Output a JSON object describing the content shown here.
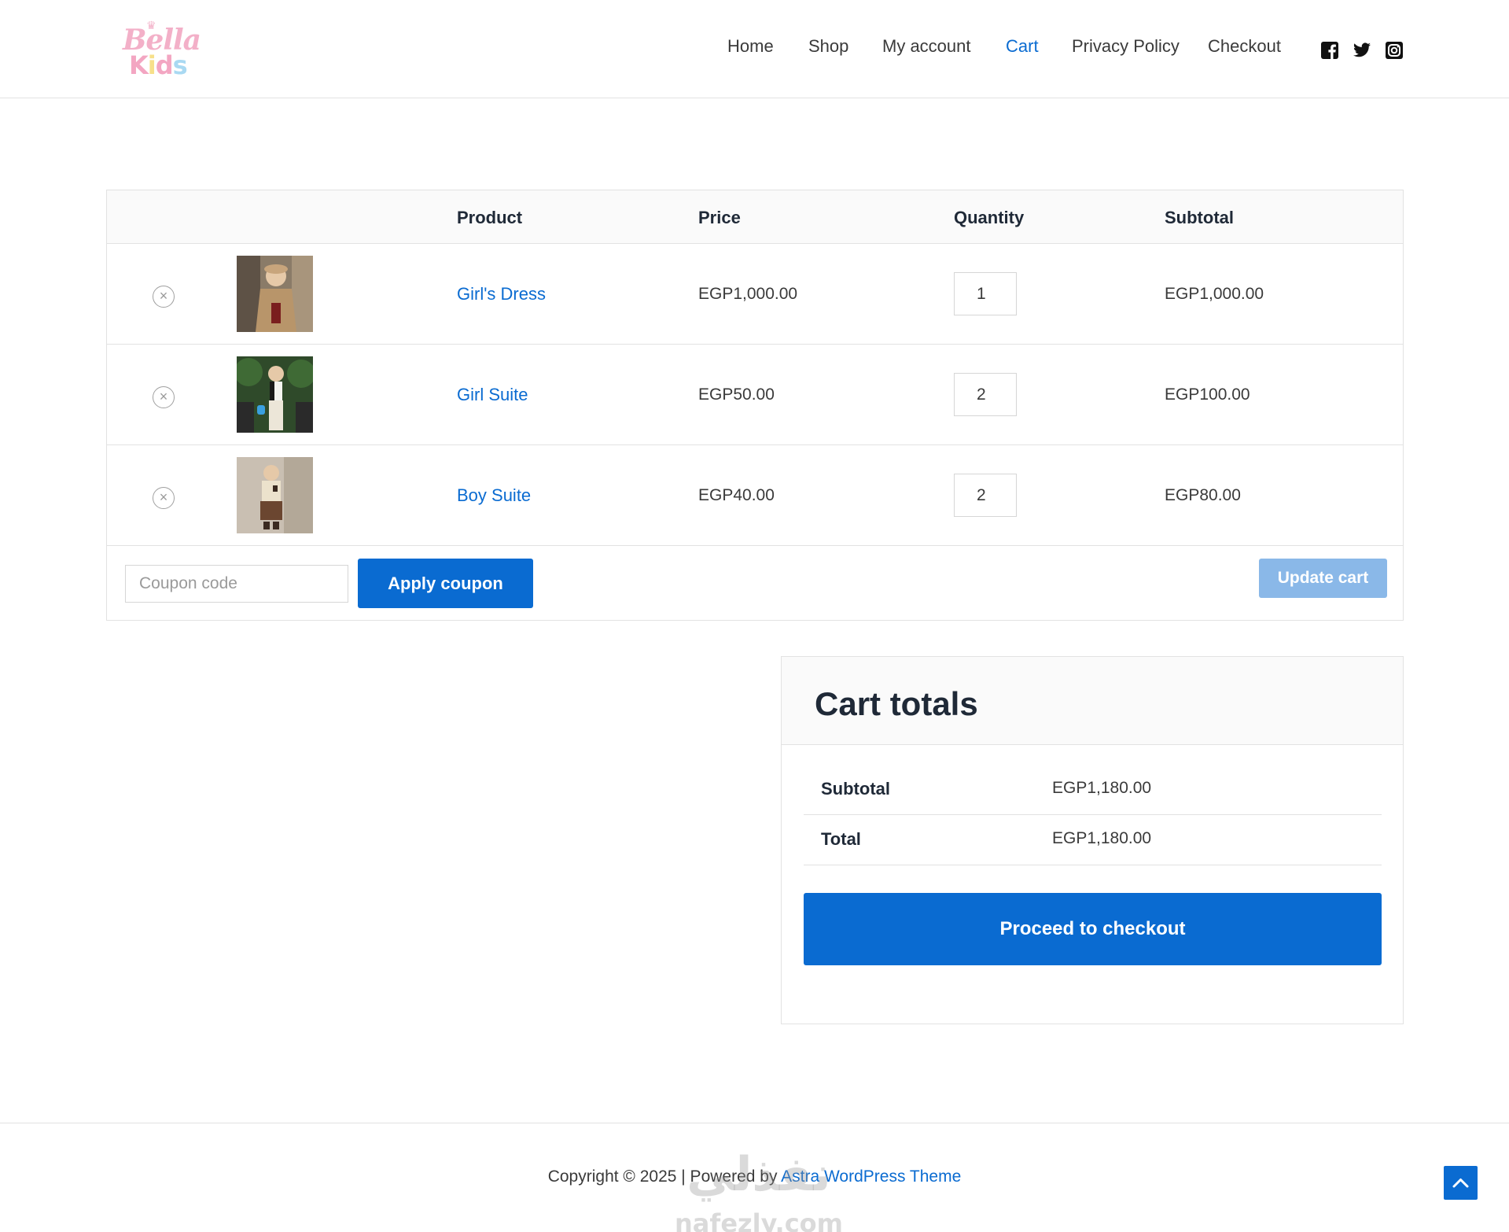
{
  "header": {
    "logo": {
      "line1": "Bella",
      "line2": "Kids"
    },
    "nav": [
      {
        "label": "Home"
      },
      {
        "label": "Shop"
      },
      {
        "label": "My account"
      },
      {
        "label": "Cart",
        "active": true
      },
      {
        "label": "Privacy Policy"
      },
      {
        "label": "Checkout"
      }
    ],
    "social": [
      "facebook-icon",
      "twitter-icon",
      "instagram-icon"
    ]
  },
  "cart": {
    "columns": {
      "product": "Product",
      "price": "Price",
      "quantity": "Quantity",
      "subtotal": "Subtotal"
    },
    "items": [
      {
        "name": "Girl's Dress",
        "price": "EGP1,000.00",
        "quantity": "1",
        "subtotal": "EGP1,000.00"
      },
      {
        "name": "Girl Suite",
        "price": "EGP50.00",
        "quantity": "2",
        "subtotal": "EGP100.00"
      },
      {
        "name": "Boy Suite",
        "price": "EGP40.00",
        "quantity": "2",
        "subtotal": "EGP80.00"
      }
    ],
    "coupon_placeholder": "Coupon code",
    "apply_coupon_label": "Apply coupon",
    "update_cart_label": "Update cart"
  },
  "totals": {
    "title": "Cart totals",
    "subtotal_label": "Subtotal",
    "subtotal_value": "EGP1,180.00",
    "total_label": "Total",
    "total_value": "EGP1,180.00",
    "checkout_label": "Proceed to checkout"
  },
  "footer": {
    "copyright_prefix": "Copyright © 2025 | Powered by ",
    "theme_link": "Astra WordPress Theme",
    "watermark_ar": "نفذلي",
    "watermark_en": "nafezly.com"
  },
  "colors": {
    "accent": "#0a6bd1",
    "update_button_disabled": "#8ab8e8",
    "text": "#3a3a3a",
    "heading": "#1f2937",
    "border": "#e2e2e2"
  }
}
